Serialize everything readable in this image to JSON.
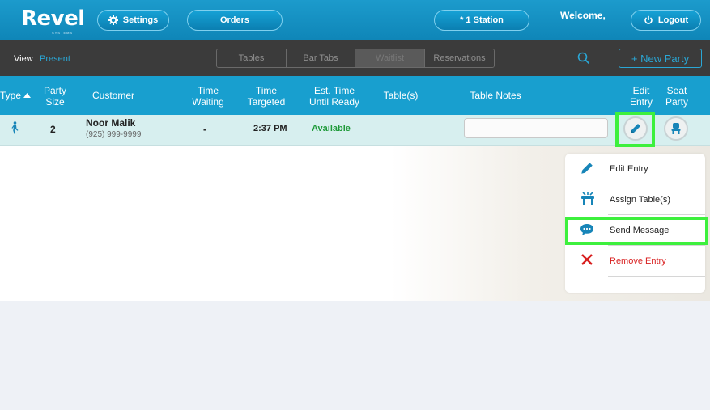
{
  "header": {
    "logo_text": "Revel",
    "logo_sub": "SYSTEMS",
    "settings_label": "Settings",
    "orders_label": "Orders",
    "station_label": "* 1 Station",
    "welcome_text": "Welcome,",
    "logout_label": "Logout"
  },
  "subbar": {
    "view_label": "View",
    "view_value": "Present",
    "tabs": [
      "Tables",
      "Bar Tabs",
      "Waitlist",
      "Reservations"
    ],
    "active_tab": "Waitlist",
    "new_party_label": "+ New Party"
  },
  "table": {
    "columns": {
      "type": "Type",
      "party_size": [
        "Party",
        "Size"
      ],
      "customer": "Customer",
      "time_waiting": [
        "Time",
        "Waiting"
      ],
      "time_targeted": [
        "Time",
        "Targeted"
      ],
      "est_time": [
        "Est. Time",
        "Until Ready"
      ],
      "tables": "Table(s)",
      "table_notes": "Table Notes",
      "edit_entry": [
        "Edit",
        "Entry"
      ],
      "seat_party": [
        "Seat",
        "Party"
      ]
    },
    "rows": [
      {
        "party_size": "2",
        "customer_name": "Noor Malik",
        "customer_phone": "(925) 999-9999",
        "time_waiting": "-",
        "time_targeted": "2:37 PM",
        "est_time": "Available",
        "tables": "",
        "table_notes": ""
      }
    ]
  },
  "menu": {
    "items": [
      {
        "label": "Edit Entry",
        "icon": "pencil-icon"
      },
      {
        "label": "Assign Table(s)",
        "icon": "table-icon"
      },
      {
        "label": "Send Message",
        "icon": "chat-icon"
      },
      {
        "label": "Remove Entry",
        "icon": "close-icon"
      }
    ]
  },
  "colors": {
    "accent": "#189fcf",
    "available": "#1f9a3a",
    "remove": "#d81e1e",
    "highlight": "#3df03d"
  }
}
